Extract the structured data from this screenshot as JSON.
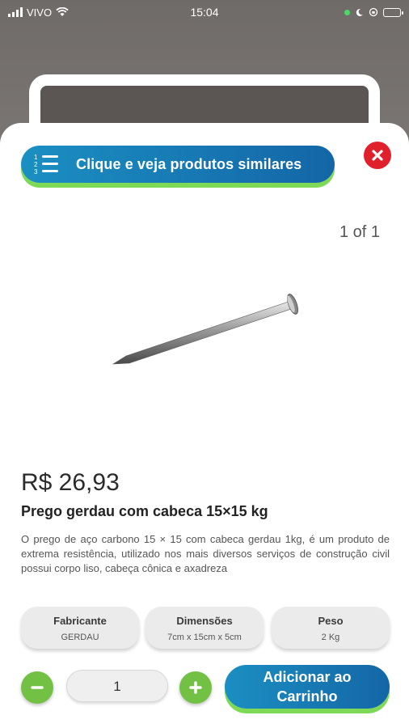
{
  "status_bar": {
    "carrier": "VIVO",
    "time": "15:04"
  },
  "header": {
    "similar_button_label": "Clique e veja produtos similares",
    "list_numbers": [
      "1",
      "2",
      "3"
    ]
  },
  "gallery": {
    "pager": "1 of 1"
  },
  "product": {
    "price": "R$ 26,93",
    "title": "Prego gerdau com cabeca 15×15 kg",
    "description": "O prego de aço carbono 15 × 15 com cabeca gerdau 1kg, é um produto de extrema resistência, utilizado nos mais diversos serviços de construção civil possui corpo liso, cabeça cônica e axadreza"
  },
  "specs": [
    {
      "label": "Fabricante",
      "value": "GERDAU"
    },
    {
      "label": "Dimensões",
      "value": "7cm x 15cm x 5cm"
    },
    {
      "label": "Peso",
      "value": "2 Kg"
    }
  ],
  "cart": {
    "quantity": "1",
    "add_button_label_line1": "Adicionar ao",
    "add_button_label_line2": "Carrinho"
  },
  "colors": {
    "primary_blue": "#1b8fc2",
    "accent_green": "#7ed957",
    "close_red": "#e0202a"
  }
}
